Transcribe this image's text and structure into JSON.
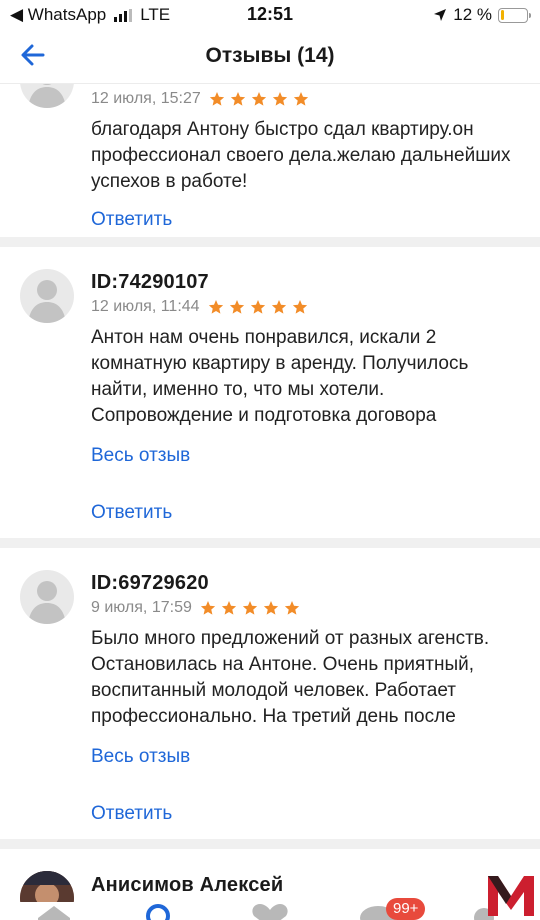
{
  "status_bar": {
    "back_app": "◀ WhatsApp",
    "network": "LTE",
    "time": "12:51",
    "battery_percent": "12 %",
    "battery_level": 0.12
  },
  "header": {
    "title": "Отзывы (14)"
  },
  "reviews": [
    {
      "date": "12 июля, 15:27",
      "rating": 5,
      "text": "благодаря Антону быстро сдал квартиру.он профессионал своего дела.желаю дальнейших успехов в работе!",
      "reply_label": "Ответить"
    },
    {
      "name": "ID:74290107",
      "date": "12 июля, 11:44",
      "rating": 5,
      "text": "Антон нам очень понравился, искали 2 комнатную квартиру в аренду. Получилось найти, именно то, что мы хотели. Сопровождение и подготовка договора",
      "more_label": "Весь отзыв",
      "reply_label": "Ответить"
    },
    {
      "name": "ID:69729620",
      "date": "9 июля, 17:59",
      "rating": 5,
      "text": "Было много предложений от разных агенств. Остановилась на Антоне. Очень приятный, воспитанный молодой человек. Работает профессионально. На третий день после",
      "more_label": "Весь отзыв",
      "reply_label": "Ответить"
    },
    {
      "name": "Анисимов Алексей"
    }
  ],
  "tab_bar": {
    "badge": "99+"
  },
  "icons": {
    "back": "arrow-left-icon",
    "star": "star-icon",
    "avatar": "user-silhouette-icon",
    "home": "home-icon",
    "search": "search-icon",
    "favorites": "heart-icon",
    "chat": "chat-icon",
    "logo": "m-logo-icon"
  },
  "colors": {
    "accent": "#1f67d8",
    "star": "#f28c28",
    "badge": "#e84a3c",
    "divider": "#f0f0f0"
  }
}
